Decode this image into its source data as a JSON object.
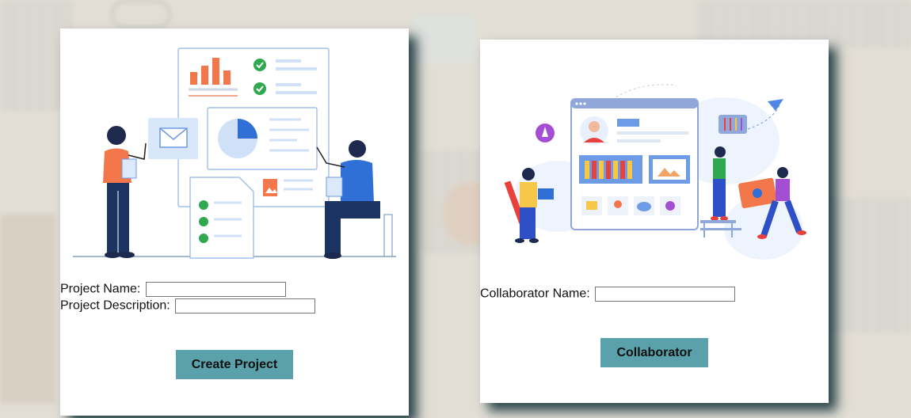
{
  "project_form": {
    "name_label": "Project Name:",
    "name_value": "",
    "description_label": "Project Description:",
    "description_value": "",
    "submit_label": "Create Project"
  },
  "collaborator_form": {
    "name_label": "Collaborator Name:",
    "name_value": "",
    "submit_label": "Collaborator"
  },
  "colors": {
    "button": "#5aa1ab",
    "card_shadow": "#143237",
    "accent_orange": "#f2784b",
    "accent_blue": "#2f6fd6"
  }
}
